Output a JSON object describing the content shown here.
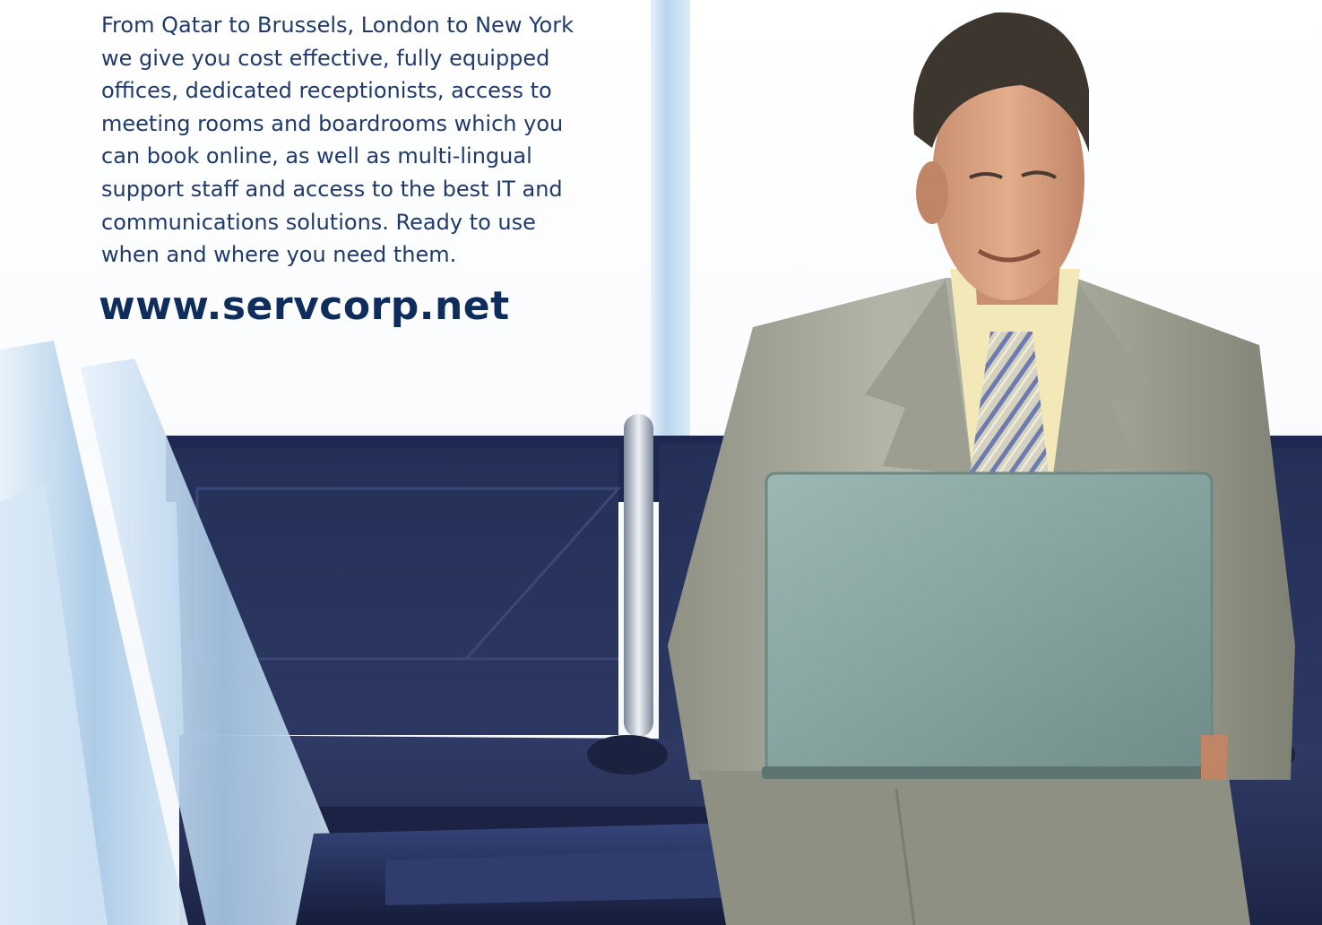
{
  "ad": {
    "body_lines": [
      "From Qatar to Brussels, London to New York",
      "we give you cost effective, fully equipped",
      "offices, dedicated receptionists, access to",
      "meeting rooms and boardrooms which you",
      "can book online, as well as multi-lingual",
      "support staff and access to the best IT and",
      "communications solutions. Ready to use",
      "when and where you need them."
    ],
    "url": "www.servcorp.net"
  },
  "colors": {
    "text": "#1f3a6b",
    "url": "#0f2d5c",
    "sofa": "#2a3560",
    "suit": "#a9ab9e",
    "laptop": "#8aa5a0"
  }
}
